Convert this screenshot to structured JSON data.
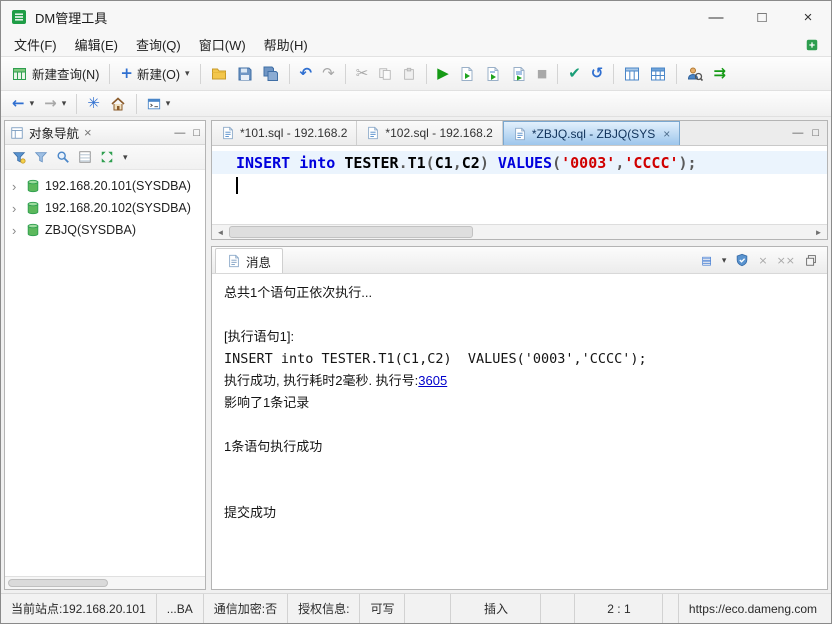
{
  "window": {
    "title": "DM管理工具"
  },
  "menu": {
    "items": [
      "文件(F)",
      "编辑(E)",
      "查询(Q)",
      "窗口(W)",
      "帮助(H)"
    ]
  },
  "toolbar": {
    "new_query_label": "新建查询(N)",
    "new_label": "新建(O)"
  },
  "navigator": {
    "title": "对象导航",
    "nodes": [
      "192.168.20.101(SYSDBA)",
      "192.168.20.102(SYSDBA)",
      "ZBJQ(SYSDBA)"
    ]
  },
  "editor": {
    "tabs": [
      {
        "label": "*101.sql - 192.168.2"
      },
      {
        "label": "*102.sql - 192.168.2"
      },
      {
        "label": "*ZBJQ.sql - ZBJQ(SYS"
      }
    ],
    "code": {
      "line": "INSERT into TESTER.T1(C1,C2) VALUES('0003','CCCC');",
      "tokens": [
        {
          "t": "INSERT",
          "type": "keyword"
        },
        {
          "t": " ",
          "type": "plain"
        },
        {
          "t": "into",
          "type": "keyword"
        },
        {
          "t": " ",
          "type": "plain"
        },
        {
          "t": "TESTER",
          "type": "identifier"
        },
        {
          "t": ".",
          "type": "punct"
        },
        {
          "t": "T1",
          "type": "identifier"
        },
        {
          "t": "(",
          "type": "punct"
        },
        {
          "t": "C1",
          "type": "identifier"
        },
        {
          "t": ",",
          "type": "punct"
        },
        {
          "t": "C2",
          "type": "identifier"
        },
        {
          "t": ") ",
          "type": "punct"
        },
        {
          "t": "VALUES",
          "type": "keyword"
        },
        {
          "t": "(",
          "type": "punct"
        },
        {
          "t": "'0003'",
          "type": "string"
        },
        {
          "t": ",",
          "type": "punct"
        },
        {
          "t": "'CCCC'",
          "type": "string"
        },
        {
          "t": ");",
          "type": "punct"
        }
      ]
    }
  },
  "messages": {
    "tab_label": "消息",
    "line_running": "总共1个语句正依次执行...",
    "line_stmt_header": "[执行语句1]:",
    "line_sql": "INSERT into TESTER.T1(C1,C2)  VALUES('0003','CCCC');",
    "line_result_prefix": "执行成功, 执行耗时2毫秒. 执行号:",
    "exec_number": "3605",
    "line_affected": "影响了1条记录",
    "line_success": "1条语句执行成功",
    "line_commit": "提交成功"
  },
  "statusbar": {
    "site": "当前站点:192.168.20.101",
    "site_more": "...BA",
    "encryption": "通信加密:否",
    "license": "授权信息:",
    "writable": "可写",
    "insert_mode": "插入",
    "caret_position": "2 : 1",
    "url": "https://eco.dameng.com"
  },
  "icons": {
    "dropdown": "▾",
    "plus": "+",
    "undo": "↶",
    "redo": "↷",
    "cut": "✂",
    "run": "▶",
    "stop": "■",
    "commit": "✔",
    "rollback": "↺",
    "back": "←",
    "forward": "→",
    "asterisk": "✳",
    "home": "⌂",
    "console_menu": "▤",
    "close": "×",
    "minimize": "—",
    "maximize": "□",
    "twisty": "›",
    "scroll_left": "◄",
    "scroll_right": "►",
    "double_close": "××"
  }
}
